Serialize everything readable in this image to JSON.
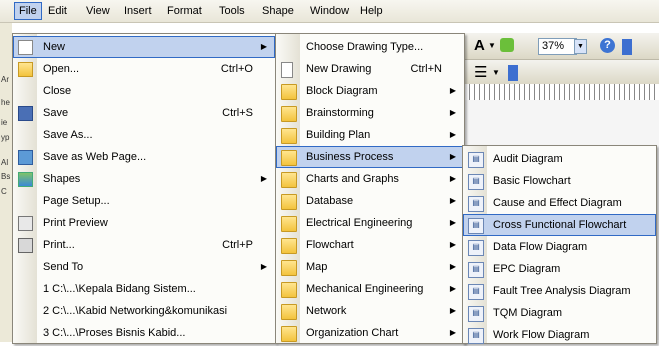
{
  "menubar": [
    {
      "label": "File",
      "active": true
    },
    {
      "label": "Edit"
    },
    {
      "label": "View"
    },
    {
      "label": "Insert"
    },
    {
      "label": "Format"
    },
    {
      "label": "Tools"
    },
    {
      "label": "Shape"
    },
    {
      "label": "Window"
    },
    {
      "label": "Help"
    }
  ],
  "toolbar": {
    "font_btn": "A",
    "zoom": "37%"
  },
  "file_menu": [
    {
      "label": "New",
      "arrow": true,
      "hl": true
    },
    {
      "label": "Open...",
      "shortcut": "Ctrl+O"
    },
    {
      "label": "Close"
    },
    {
      "label": "Save",
      "shortcut": "Ctrl+S"
    },
    {
      "label": "Save As..."
    },
    {
      "label": "Save as Web Page..."
    },
    {
      "label": "Shapes",
      "arrow": true
    },
    {
      "label": "Page Setup..."
    },
    {
      "label": "Print Preview"
    },
    {
      "label": "Print...",
      "shortcut": "Ctrl+P"
    },
    {
      "label": "Send To",
      "arrow": true
    },
    {
      "label": "1 C:\\...\\Kepala Bidang Sistem..."
    },
    {
      "label": "2 C:\\...\\Kabid Networking&komunikasi"
    },
    {
      "label": "3 C:\\...\\Proses Bisnis Kabid..."
    }
  ],
  "new_menu": [
    {
      "label": "Choose Drawing Type..."
    },
    {
      "label": "New Drawing",
      "shortcut": "Ctrl+N"
    },
    {
      "label": "Block Diagram",
      "arrow": true
    },
    {
      "label": "Brainstorming",
      "arrow": true
    },
    {
      "label": "Building Plan",
      "arrow": true
    },
    {
      "label": "Business Process",
      "arrow": true,
      "hl": true
    },
    {
      "label": "Charts and Graphs",
      "arrow": true
    },
    {
      "label": "Database",
      "arrow": true
    },
    {
      "label": "Electrical Engineering",
      "arrow": true
    },
    {
      "label": "Flowchart",
      "arrow": true
    },
    {
      "label": "Map",
      "arrow": true
    },
    {
      "label": "Mechanical Engineering",
      "arrow": true
    },
    {
      "label": "Network",
      "arrow": true
    },
    {
      "label": "Organization Chart",
      "arrow": true
    }
  ],
  "bp_menu": [
    {
      "label": "Audit Diagram"
    },
    {
      "label": "Basic Flowchart"
    },
    {
      "label": "Cause and Effect Diagram"
    },
    {
      "label": "Cross Functional Flowchart",
      "hl": true
    },
    {
      "label": "Data Flow Diagram"
    },
    {
      "label": "EPC Diagram"
    },
    {
      "label": "Fault Tree Analysis Diagram"
    },
    {
      "label": "TQM Diagram"
    },
    {
      "label": "Work Flow Diagram"
    }
  ],
  "left_labels": [
    "Ar",
    "he",
    "ie",
    "yp",
    "Al",
    "Bs",
    "C"
  ]
}
